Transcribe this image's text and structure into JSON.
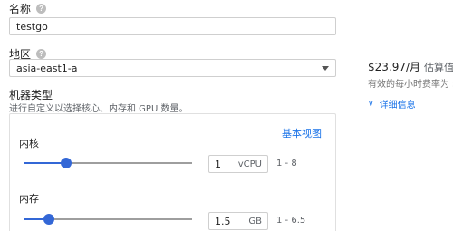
{
  "name_field": {
    "label": "名称",
    "value": "testgo"
  },
  "region_field": {
    "label": "地区",
    "value": "asia-east1-a"
  },
  "machine_type": {
    "title": "机器类型",
    "description": "进行自定义以选择核心、内存和 GPU 数量。",
    "basic_view_link": "基本视图",
    "cores": {
      "label": "内核",
      "value": "1",
      "unit": "vCPU",
      "range": "1 - 8",
      "level": 0.25
    },
    "memory": {
      "label": "内存",
      "value": "1.5",
      "unit": "GB",
      "range": "1 - 6.5",
      "level": 0.15
    }
  },
  "pricing": {
    "amount": "$23.97/月",
    "amount_label": "估算值",
    "note": "有效的每小时费率为 $",
    "details_link": "详细信息"
  },
  "icons": {
    "help": "question-circle-icon",
    "dropdown": "caret-down-icon",
    "expand": "chevron-double-down-icon"
  }
}
